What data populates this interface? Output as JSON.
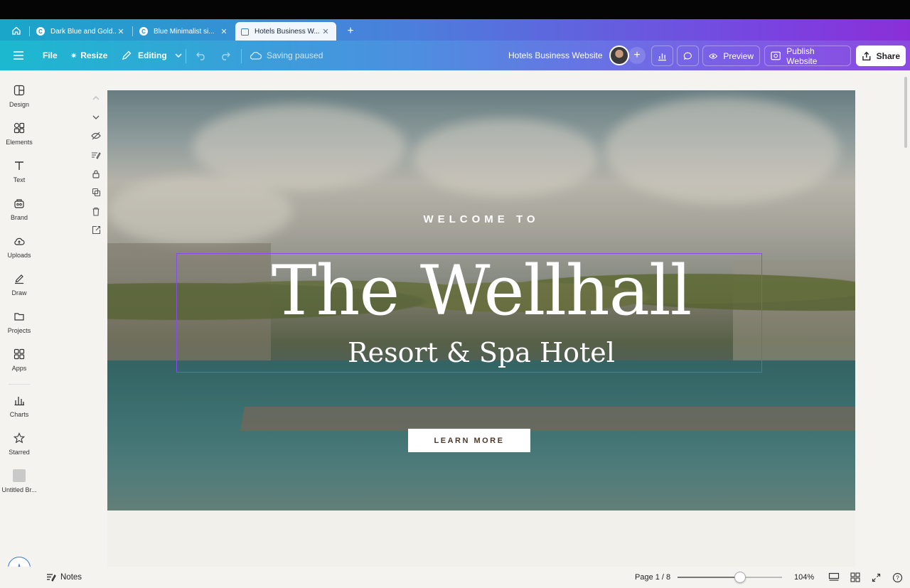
{
  "browser": {
    "tabs": [
      {
        "title": "Dark Blue and Gold...",
        "favicon": "C",
        "active": false
      },
      {
        "title": "Blue Minimalist si...",
        "favicon": "C",
        "active": false
      },
      {
        "title": "Hotels Business W...",
        "favicon": "",
        "active": true
      }
    ]
  },
  "toolbar": {
    "file_label": "File",
    "resize_label": "Resize",
    "editing_label": "Editing",
    "saving_status": "Saving paused",
    "doc_title": "Hotels Business Website",
    "preview_label": "Preview",
    "publish_label": "Publish Website",
    "share_label": "Share"
  },
  "sidebar": {
    "items": [
      {
        "label": "Design",
        "icon": "design-icon"
      },
      {
        "label": "Elements",
        "icon": "elements-icon"
      },
      {
        "label": "Text",
        "icon": "text-icon"
      },
      {
        "label": "Brand",
        "icon": "brand-icon"
      },
      {
        "label": "Uploads",
        "icon": "uploads-icon"
      },
      {
        "label": "Draw",
        "icon": "draw-icon"
      },
      {
        "label": "Projects",
        "icon": "projects-icon"
      },
      {
        "label": "Apps",
        "icon": "apps-icon"
      },
      {
        "label": "Charts",
        "icon": "charts-icon"
      },
      {
        "label": "Starred",
        "icon": "star-icon"
      },
      {
        "label": "Untitled Br...",
        "icon": "thumbnail-icon"
      }
    ]
  },
  "canvas": {
    "welcome": "WELCOME TO",
    "title": "The Wellhall",
    "subtitle": "Resort & Spa Hotel",
    "cta": "LEARN MORE"
  },
  "bottombar": {
    "notes_label": "Notes",
    "page_indicator": "Page 1 / 8",
    "zoom": "104%",
    "zoom_fraction": 0.6
  },
  "colors": {
    "accent_purple": "#8a4bf0",
    "toolbar_start": "#1bb9cf",
    "toolbar_end": "#8c4ae0"
  }
}
